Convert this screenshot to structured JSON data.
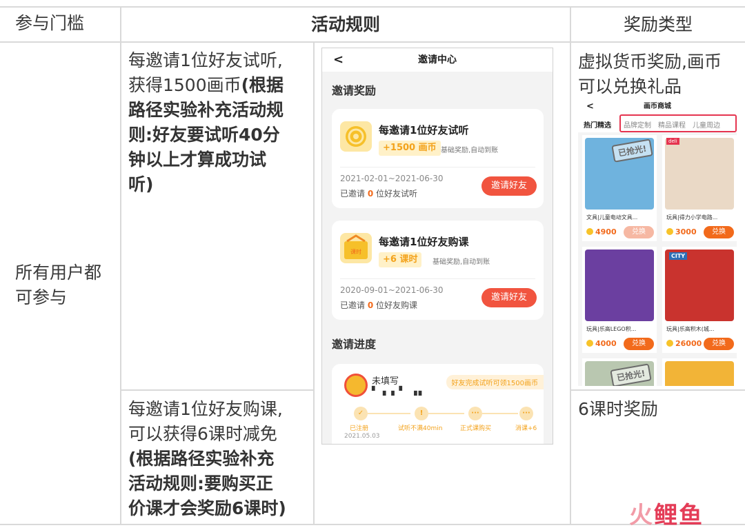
{
  "table": {
    "headers": {
      "threshold": "参与门槛",
      "rules": "活动规则",
      "reward_type": "奖励类型"
    },
    "threshold_value": [
      "所有用户都",
      "可参与"
    ],
    "row1": {
      "rule_normal": [
        "每邀请1位好友试听,",
        "获得1500画币"
      ],
      "rule_bold": [
        "(根据",
        "路径实验补充活动规",
        "则:好友要试听40分",
        "钟以上才算成功试",
        "听)"
      ],
      "reward": [
        "虚拟货币奖励,画币",
        "可以兑换礼品"
      ]
    },
    "row2": {
      "rule_normal": [
        "每邀请1位好友购课,",
        "可以获得6课时减免"
      ],
      "rule_bold": [
        "(根据路径实验补充",
        "活动规则:要购买正",
        "价课才会奖励6课时)"
      ],
      "reward": "6课时奖励"
    }
  },
  "invite_screen": {
    "back": "<",
    "title": "邀请中心",
    "section_rewards": "邀请奖励",
    "cards": [
      {
        "title": "每邀请1位好友试听",
        "reward": "+1500 画币",
        "reward_note": "基础奖励,自动到账",
        "date": "2021-02-01~2021-06-30",
        "status_prefix": "已邀请",
        "count": "0",
        "status_suffix": "位好友试听",
        "button": "邀请好友"
      },
      {
        "title": "每邀请1位好友购课",
        "reward": "+6 课时",
        "reward_note": "基础奖励,自动到账",
        "date": "2020-09-01~2021-06-30",
        "status_prefix": "已邀请",
        "count": "0",
        "status_suffix": "位好友购课",
        "button": "邀请好友",
        "icon_text": "课时"
      }
    ],
    "section_progress": "邀请进度",
    "progress": {
      "nickname": "未填写",
      "masked_id": "▘▗ ▖▘ ▗▖",
      "tag": "好友完成试听可领1500画币",
      "steps": [
        "已注册",
        "试听不满40min",
        "正式课购买",
        "消课+6"
      ],
      "step_icons": [
        "✓",
        "!",
        "···",
        "···"
      ],
      "date": "2021.05.03"
    }
  },
  "mall_screen": {
    "back": "<",
    "title": "画币商城",
    "tabs": [
      "热门精选",
      "品牌定制",
      "精品课程",
      "儿童周边"
    ],
    "products": [
      {
        "name": "文具|儿童电动文具...",
        "price": "4900",
        "button": "兑换",
        "stamp": "已抢光!",
        "button_color": "#f6b8a3",
        "img_color": "#6fb3de",
        "brand": ""
      },
      {
        "name": "玩具|得力小学电路...",
        "price": "3000",
        "button": "兑换",
        "stamp": "",
        "button_color": "#f26a1b",
        "img_color": "#ead9c6",
        "brand": "deli"
      },
      {
        "name": "玩具|乐高LEGO积...",
        "price": "4000",
        "button": "兑换",
        "stamp": "",
        "button_color": "#f26a1b",
        "img_color": "#6b3fa0",
        "brand": ""
      },
      {
        "name": "玩具|乐高积木(城...",
        "price": "26000",
        "button": "兑换",
        "stamp": "",
        "button_color": "#f26a1b",
        "img_color": "#c9332e",
        "brand": "CITY"
      }
    ],
    "partial_stamp": "已抢光!"
  },
  "watermark": {
    "part1": "火",
    "part2": "鲤鱼"
  }
}
